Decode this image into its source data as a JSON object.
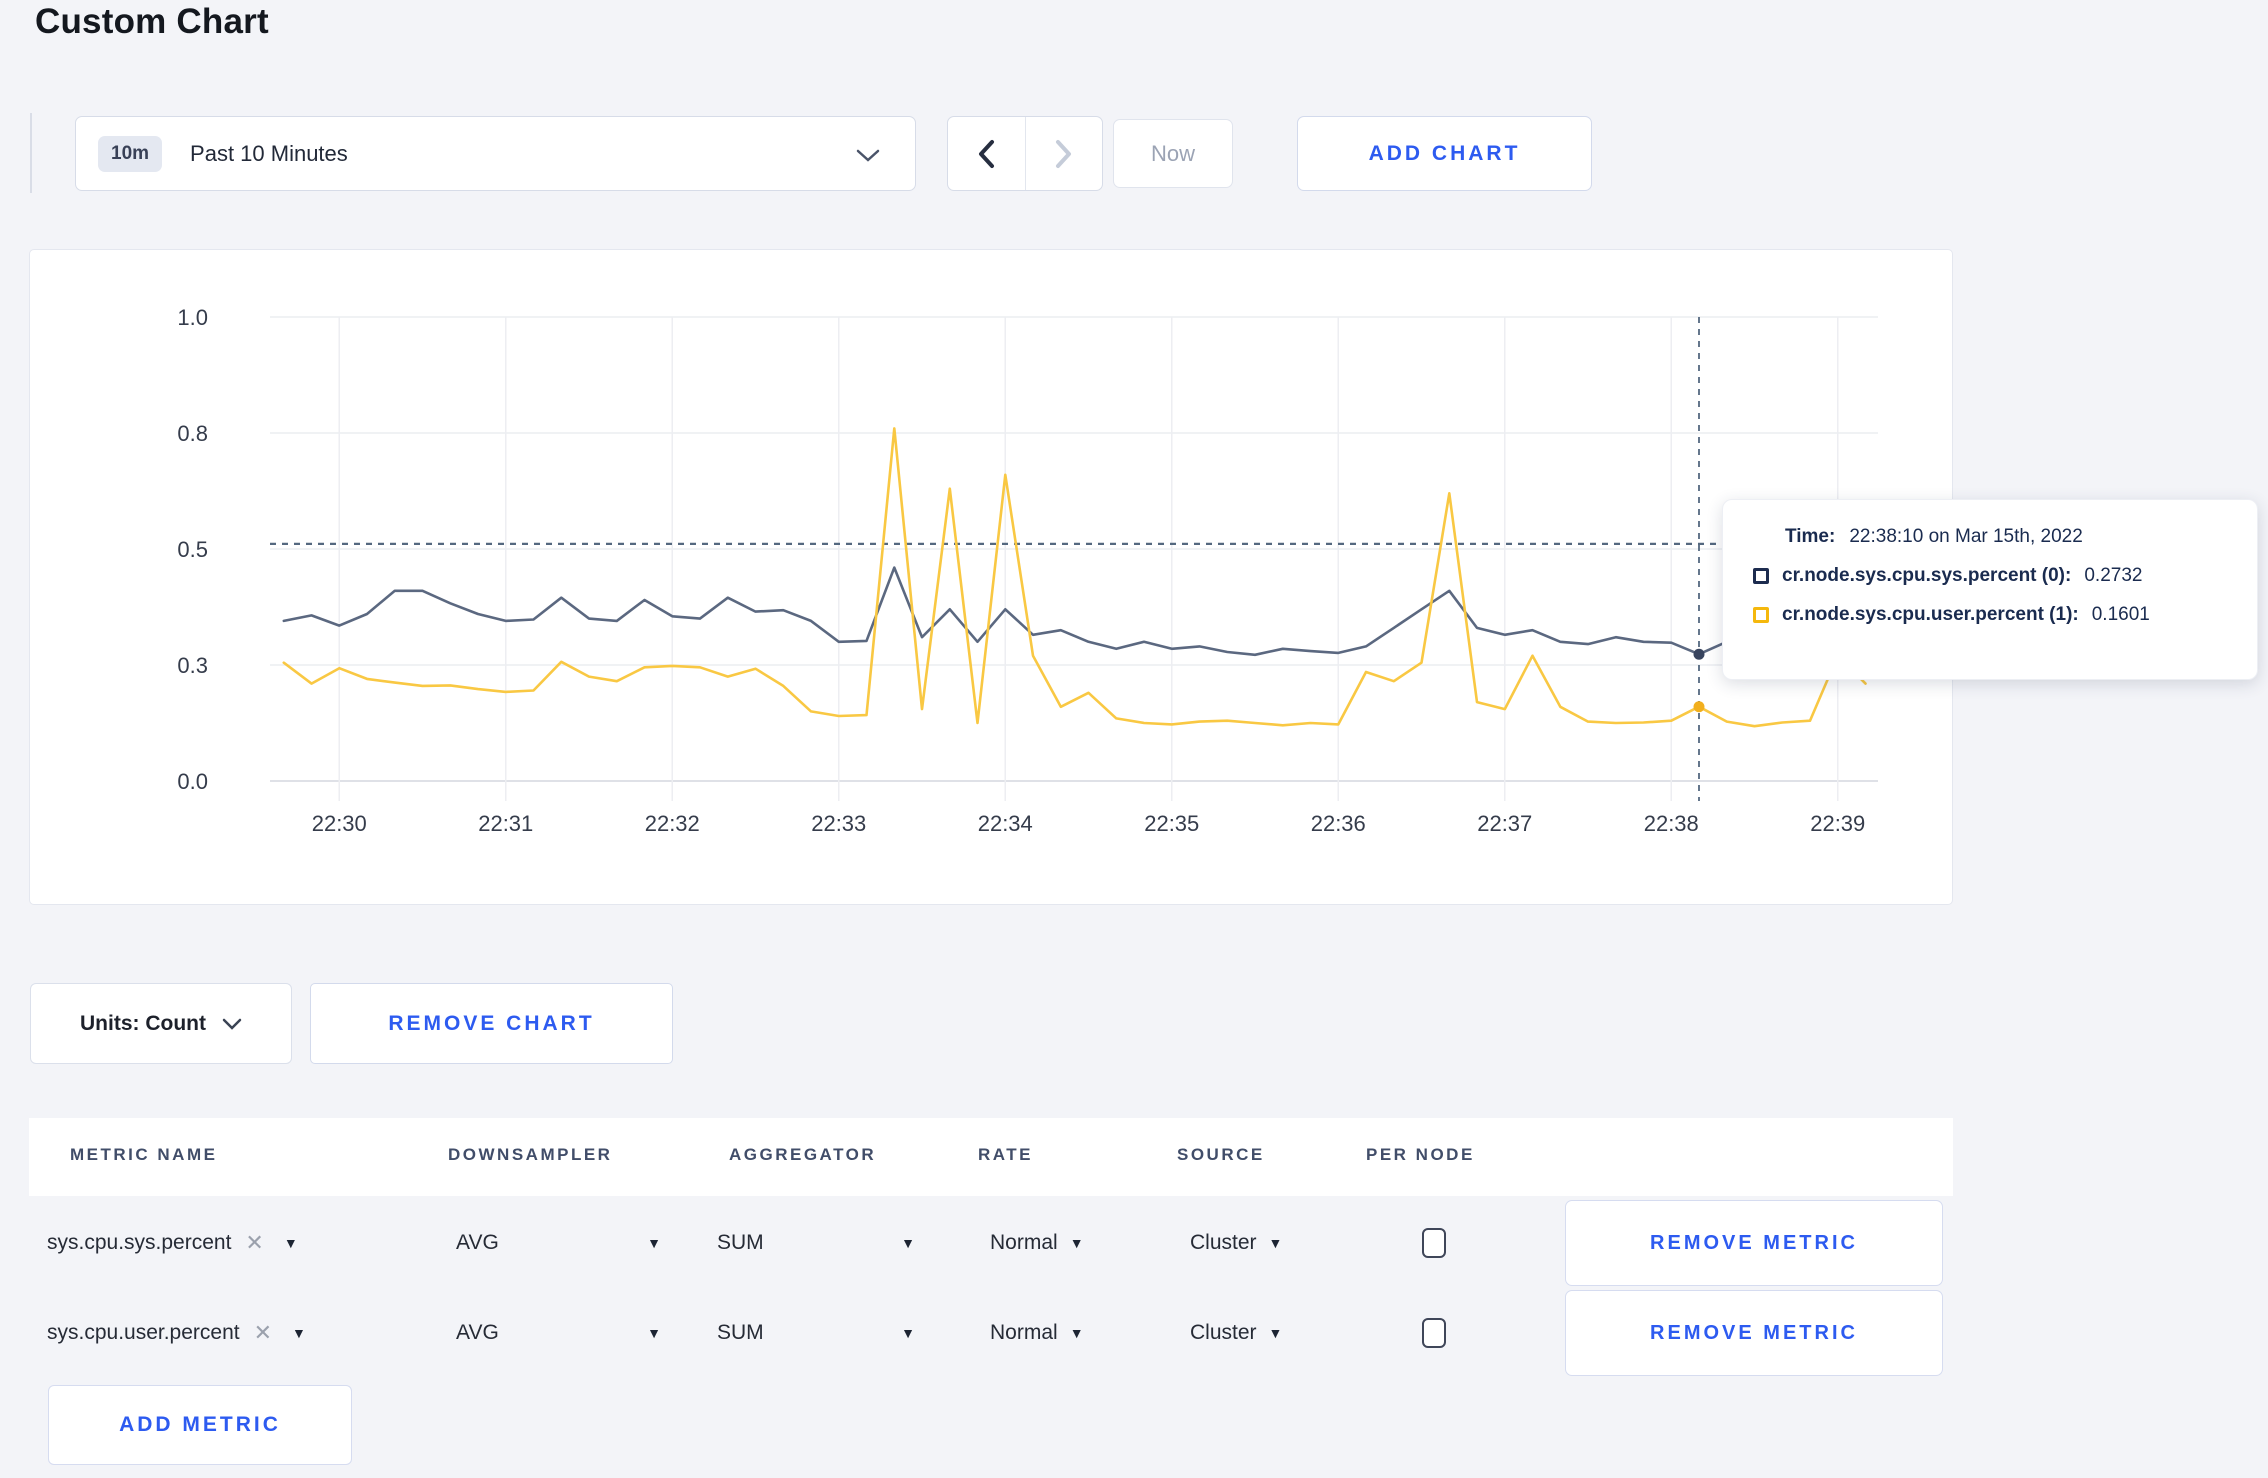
{
  "page": {
    "title": "Custom Chart"
  },
  "colors": {
    "accent_blue": "#2d5bf0",
    "series_sys_line": "#5b6880",
    "series_user_line": "#f9c843",
    "crosshair": "#54687f",
    "page_background": "#f3f4f8"
  },
  "icons": {
    "dropdown_caret": "▼",
    "close": "✕"
  },
  "toolbar": {
    "time_selector": {
      "badge": "10m",
      "label": "Past 10 Minutes"
    },
    "now_label": "Now",
    "add_chart_label": "ADD CHART"
  },
  "chart_controls": {
    "units_label": "Units: Count",
    "remove_chart_label": "REMOVE CHART"
  },
  "tooltip": {
    "time_label": "Time:",
    "time_value": "22:38:10 on Mar 15th, 2022",
    "series": [
      {
        "label": "cr.node.sys.cpu.sys.percent (0):",
        "value": "0.2732",
        "swatch_color": "#1d2c4f"
      },
      {
        "label": "cr.node.sys.cpu.user.percent (1):",
        "value": "0.1601",
        "swatch_color": "#f5b80d"
      }
    ]
  },
  "metrics_table": {
    "headers": [
      "METRIC NAME",
      "DOWNSAMPLER",
      "AGGREGATOR",
      "RATE",
      "SOURCE",
      "PER NODE"
    ],
    "rows": [
      {
        "metric": "sys.cpu.sys.percent",
        "downsampler": "AVG",
        "aggregator": "SUM",
        "rate": "Normal",
        "source": "Cluster",
        "per_node_checked": false,
        "remove_label": "REMOVE METRIC"
      },
      {
        "metric": "sys.cpu.user.percent",
        "downsampler": "AVG",
        "aggregator": "SUM",
        "rate": "Normal",
        "source": "Cluster",
        "per_node_checked": false,
        "remove_label": "REMOVE METRIC"
      }
    ],
    "add_metric_label": "ADD METRIC"
  },
  "chart_data": {
    "type": "line",
    "title": "",
    "xlabel": "",
    "ylabel": "",
    "ylim": [
      0,
      1
    ],
    "grid": true,
    "x_start_time": "22:29:40",
    "x_interval_seconds": 10,
    "x_ticks": [
      "22:30",
      "22:31",
      "22:32",
      "22:33",
      "22:34",
      "22:35",
      "22:36",
      "22:37",
      "22:38",
      "22:39"
    ],
    "y_tick_labels": [
      "0.0",
      "0.3",
      "0.5",
      "0.8",
      "1.0"
    ],
    "y_tick_values": [
      0,
      0.25,
      0.5,
      0.75,
      1.0
    ],
    "series": [
      {
        "name": "cr.node.sys.cpu.sys.percent",
        "color": "#5b6880",
        "values": [
          0.345,
          0.357,
          0.335,
          0.36,
          0.41,
          0.41,
          0.383,
          0.36,
          0.345,
          0.348,
          0.395,
          0.35,
          0.345,
          0.39,
          0.355,
          0.35,
          0.395,
          0.365,
          0.368,
          0.345,
          0.3,
          0.302,
          0.46,
          0.31,
          0.37,
          0.3,
          0.37,
          0.315,
          0.325,
          0.3,
          0.285,
          0.3,
          0.285,
          0.29,
          0.278,
          0.272,
          0.285,
          0.28,
          0.276,
          0.29,
          0.33,
          0.37,
          0.41,
          0.33,
          0.315,
          0.325,
          0.3,
          0.295,
          0.31,
          0.3,
          0.298,
          0.2732,
          0.3,
          0.315,
          0.295,
          0.3,
          0.31,
          0.29
        ]
      },
      {
        "name": "cr.node.sys.cpu.user.percent",
        "color": "#f9c843",
        "values": [
          0.255,
          0.21,
          0.243,
          0.22,
          0.212,
          0.205,
          0.206,
          0.198,
          0.192,
          0.195,
          0.257,
          0.225,
          0.215,
          0.245,
          0.248,
          0.245,
          0.225,
          0.242,
          0.205,
          0.15,
          0.14,
          0.142,
          0.76,
          0.155,
          0.63,
          0.125,
          0.66,
          0.27,
          0.16,
          0.19,
          0.135,
          0.125,
          0.122,
          0.128,
          0.13,
          0.125,
          0.12,
          0.125,
          0.122,
          0.235,
          0.215,
          0.255,
          0.62,
          0.17,
          0.155,
          0.27,
          0.16,
          0.128,
          0.125,
          0.126,
          0.13,
          0.1601,
          0.128,
          0.118,
          0.126,
          0.13,
          0.27,
          0.21
        ]
      }
    ],
    "hover": {
      "time": "22:38:10",
      "index": 51,
      "hline_value": 0.511,
      "values": [
        0.2732,
        0.1601
      ],
      "dot_colors": [
        "#38445e",
        "#f2af1d"
      ]
    }
  }
}
